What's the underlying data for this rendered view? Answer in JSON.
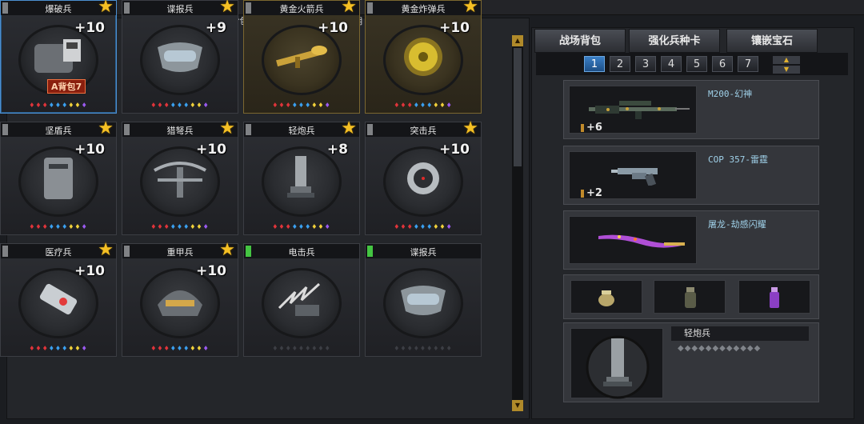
{
  "notice": "战场背包兵种卡只能在超级佣兵中使用",
  "cards": [
    {
      "name": "爆破兵",
      "level": "+10",
      "star": true,
      "lock": "gray",
      "style": "selected",
      "badge": "A背包7",
      "art": "backpack-bomb-art"
    },
    {
      "name": "谍报兵",
      "level": "+9",
      "star": true,
      "lock": "gray",
      "style": "normal",
      "art": "spy-mask-art"
    },
    {
      "name": "黄金火箭兵",
      "level": "+10",
      "star": true,
      "lock": "gray",
      "style": "gold",
      "art": "golden-rocket-art"
    },
    {
      "name": "黄金炸弹兵",
      "level": "+10",
      "star": true,
      "lock": "gray",
      "style": "gold",
      "art": "golden-bomb-art"
    },
    {
      "name": "坚盾兵",
      "level": "+10",
      "star": true,
      "lock": "gray",
      "style": "normal",
      "art": "shield-art"
    },
    {
      "name": "猎弩兵",
      "level": "+10",
      "star": true,
      "lock": "gray",
      "style": "normal",
      "art": "crossbow-art"
    },
    {
      "name": "轻炮兵",
      "level": "+8",
      "star": true,
      "lock": "gray",
      "style": "normal",
      "art": "mortar-art"
    },
    {
      "name": "突击兵",
      "level": "+10",
      "star": true,
      "lock": "gray",
      "style": "normal",
      "art": "assault-mine-art"
    },
    {
      "name": "医疗兵",
      "level": "+10",
      "star": true,
      "lock": "gray",
      "style": "normal",
      "art": "medkit-art"
    },
    {
      "name": "重甲兵",
      "level": "+10",
      "star": true,
      "lock": "gray",
      "style": "normal",
      "art": "heavy-helmet-art"
    },
    {
      "name": "电击兵",
      "level": "",
      "star": false,
      "lock": "green",
      "style": "normal",
      "art": "electric-claw-art"
    },
    {
      "name": "谍报兵",
      "level": "",
      "star": false,
      "lock": "green",
      "style": "normal",
      "art": "spy-mask-art"
    }
  ],
  "tabs": [
    {
      "label": "战场背包",
      "active": true
    },
    {
      "label": "强化兵种卡",
      "active": false
    },
    {
      "label": "镶嵌宝石",
      "active": false
    }
  ],
  "pages": [
    "1",
    "2",
    "3",
    "4",
    "5",
    "6",
    "7"
  ],
  "active_page": "1",
  "weapons": [
    {
      "name": "M200-幻神",
      "count": "+6"
    },
    {
      "name": "COP 357-雷霆",
      "count": "+2"
    },
    {
      "name": "屠龙-劫感闪耀",
      "count": ""
    }
  ],
  "grenades": [
    "flashbang-icon",
    "smoke-grenade-icon",
    "purple-grenade-icon"
  ],
  "equipped_card": {
    "name": "轻炮兵"
  },
  "colors": {
    "accent": "#3a7fc6",
    "star": "#f5c024",
    "gold_border": "#7b6730"
  }
}
